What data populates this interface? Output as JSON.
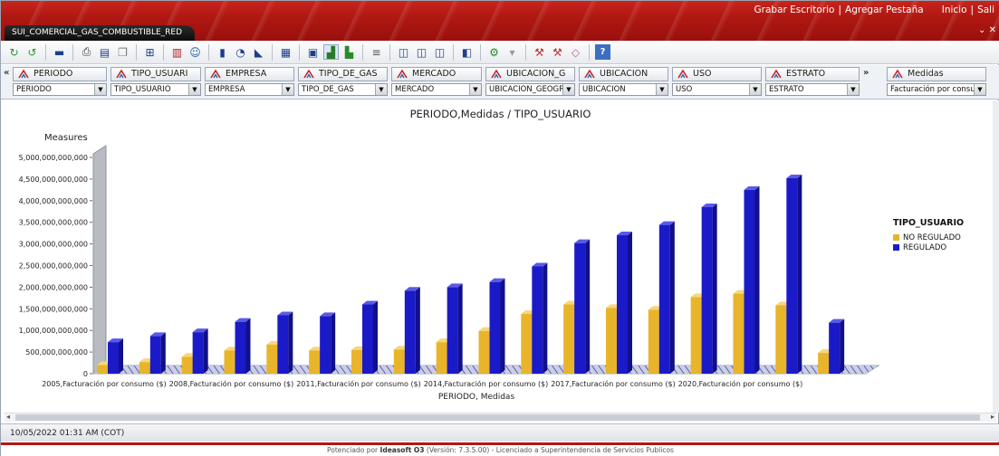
{
  "app": {
    "tab_title": "SUI_COMERCIAL_GAS_COMBUSTIBLE_RED",
    "links": [
      "Grabar Escritorio",
      "Agregar Pestaña",
      "Inicio",
      "Sali"
    ]
  },
  "toolbar_icons": [
    "refresh-icon",
    "undo-icon",
    "monitor-icon",
    "print-icon",
    "export-icon",
    "copy-icon",
    "options-icon",
    "excel-icon",
    "people-icon",
    "bar-chart-icon",
    "pie-icon",
    "triangle-icon",
    "grid-icon",
    "table-icon",
    "active-chart-icon",
    "column-icon",
    "list-icon",
    "db-icon",
    "db2-icon",
    "db3-icon",
    "cube-icon",
    "settings-icon",
    "filter-icon",
    "drill-icon",
    "drill2-icon",
    "box-icon",
    "help-icon"
  ],
  "dimensions": [
    {
      "header": "PERIODO",
      "value": "PERIODO"
    },
    {
      "header": "TIPO_USUARI",
      "value": "TIPO_USUARIO"
    },
    {
      "header": "EMPRESA",
      "value": "EMPRESA"
    },
    {
      "header": "TIPO_DE_GAS",
      "value": "TIPO_DE_GAS"
    },
    {
      "header": "MERCADO",
      "value": "MERCADO"
    },
    {
      "header": "UBICACION_G",
      "value": "UBICACION_GEOGR"
    },
    {
      "header": "UBICACION",
      "value": "UBICACION"
    },
    {
      "header": "USO",
      "value": "USO"
    },
    {
      "header": "ESTRATO",
      "value": "ESTRATO"
    }
  ],
  "measure": {
    "header": "Medidas",
    "value": "Facturación por consu"
  },
  "chart_data": {
    "type": "bar",
    "title": "PERIODO,Medidas / TIPO_USUARIO",
    "ylabel": "Measures",
    "xlabel": "PERIODO, Medidas",
    "ylim": [
      0,
      5000000000000
    ],
    "yticks": [
      "5,000,000,000,000",
      "4,500,000,000,000",
      "4,000,000,000,000",
      "3,500,000,000,000",
      "3,000,000,000,000",
      "2,500,000,000,000",
      "2,000,000,000,000",
      "1,500,000,000,000",
      "1,000,000,000,000",
      "500,000,000,000",
      "0"
    ],
    "x_tick_labels": [
      "2005,Facturación por consumo ($)",
      "2008,Facturación por consumo ($)",
      "2011,Facturación por consumo ($)",
      "2014,Facturación por consumo ($)",
      "2017,Facturación por consumo ($)",
      "2020,Facturación por consumo ($)"
    ],
    "categories": [
      "2005",
      "2006",
      "2007",
      "2008",
      "2009",
      "2010",
      "2011",
      "2012",
      "2013",
      "2014",
      "2015",
      "2016",
      "2017",
      "2018",
      "2019",
      "2020",
      "2021",
      "2022"
    ],
    "series": [
      {
        "name": "NO REGULADO",
        "color": "#e8b42a",
        "values": [
          200000000000,
          270000000000,
          390000000000,
          540000000000,
          670000000000,
          540000000000,
          550000000000,
          560000000000,
          730000000000,
          990000000000,
          1380000000000,
          1600000000000,
          1520000000000,
          1480000000000,
          1770000000000,
          1850000000000,
          1580000000000,
          480000000000
        ]
      },
      {
        "name": "REGULADO",
        "color": "#1a1ac8",
        "values": [
          730000000000,
          870000000000,
          960000000000,
          1200000000000,
          1350000000000,
          1330000000000,
          1600000000000,
          1920000000000,
          2000000000000,
          2120000000000,
          2480000000000,
          3020000000000,
          3200000000000,
          3440000000000,
          3850000000000,
          4250000000000,
          4520000000000,
          1180000000000
        ]
      }
    ],
    "legend_title": "TIPO_USUARIO",
    "legend_position": "right"
  },
  "status": {
    "timestamp": "10/05/2022 01:31 AM (COT)"
  },
  "footer": {
    "prefix": "Potenciado por",
    "brand": "Ideasoft O3",
    "rest": "(Versión: 7.3.5.00) - Licenciado a Superintendencia de Servicios Publicos"
  }
}
